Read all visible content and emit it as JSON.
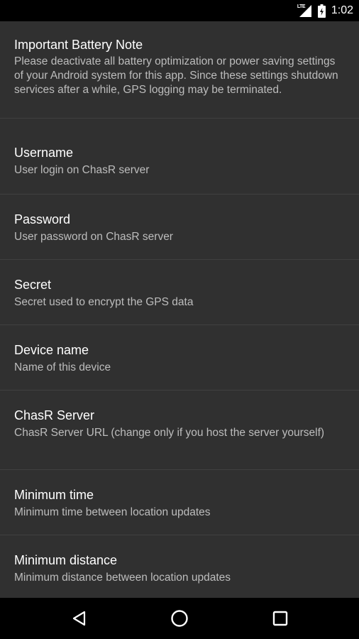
{
  "status_bar": {
    "network_label": "LTE",
    "time": "1:02"
  },
  "battery_note": {
    "title": "Important Battery Note",
    "summary": "Please deactivate all battery optimization or power saving settings of your Android system for this app. Since these settings shutdown services after a while, GPS logging may be terminated."
  },
  "preferences": [
    {
      "title": "Username",
      "summary": "User login on ChasR server"
    },
    {
      "title": "Password",
      "summary": "User password on ChasR server"
    },
    {
      "title": "Secret",
      "summary": "Secret used to encrypt the GPS data"
    },
    {
      "title": "Device name",
      "summary": "Name of this device"
    },
    {
      "title": "ChasR Server",
      "summary": "ChasR Server URL (change only if you host the server yourself)"
    },
    {
      "title": "Minimum time",
      "summary": "Minimum time between location updates"
    },
    {
      "title": "Minimum distance",
      "summary": "Minimum distance between location updates"
    }
  ],
  "nav_bar": {
    "back_icon": "back-triangle-icon",
    "home_icon": "home-circle-icon",
    "recents_icon": "recents-square-icon"
  },
  "colors": {
    "background": "#303030",
    "title_text": "#ffffff",
    "summary_text": "#bdbdbd",
    "divider": "#404040",
    "system_bars": "#000000"
  }
}
